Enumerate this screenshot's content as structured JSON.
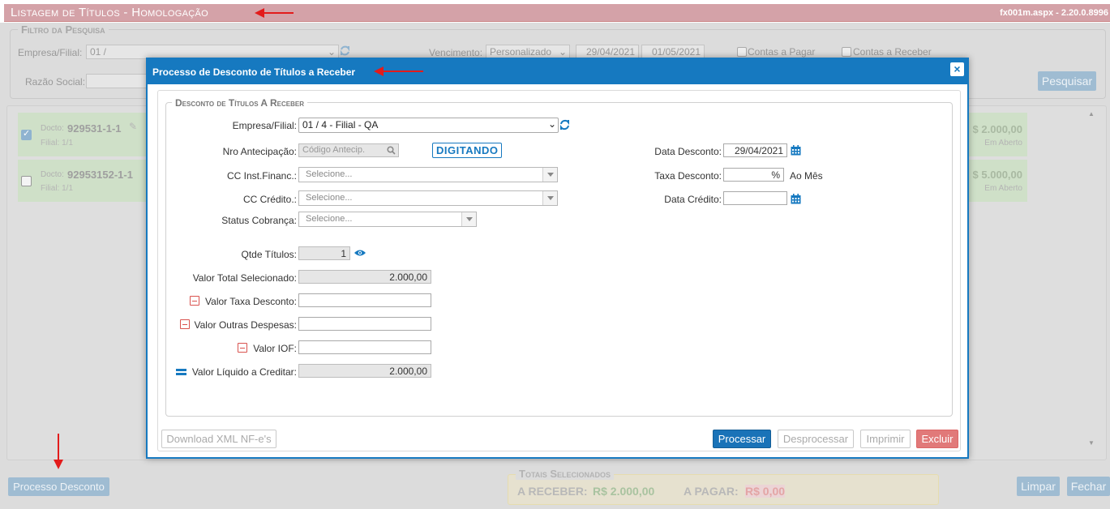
{
  "page": {
    "title": "Listagem de Títulos  - Homologação",
    "version": "fx001m.aspx - 2.20.0.8996"
  },
  "filtro": {
    "legend": "Filtro da Pesquisa",
    "empresa_label": "Empresa/Filial:",
    "empresa_value": "01 /",
    "vencimento_label": "Vencimento:",
    "vencimento_value": "Personalizado",
    "date_from": "29/04/2021",
    "date_to": "01/05/2021",
    "contas_pagar": "Contas a Pagar",
    "contas_receber": "Contas a Receber",
    "razao_label": "Razão Social:",
    "pesquisar": "Pesquisar"
  },
  "list": [
    {
      "docto_label": "Docto:",
      "docto": "929531-1-1",
      "filial": "Filial: 1/1",
      "amount": "$ 2.000,00",
      "status": "Em Aberto",
      "checked": true
    },
    {
      "docto_label": "Docto:",
      "docto": "92953152-1-1",
      "filial": "Filial: 1/1",
      "amount": "$ 5.000,00",
      "status": "Em Aberto",
      "checked": false
    }
  ],
  "bottom": {
    "processo_desconto": "Processo Desconto",
    "totais_legend": "Totais Selecionados",
    "a_receber_label": "A RECEBER:",
    "a_receber_value": "R$ 2.000,00",
    "a_pagar_label": "A PAGAR:",
    "a_pagar_value": "R$ 0,00",
    "limpar": "Limpar",
    "fechar": "Fechar"
  },
  "modal": {
    "title": "Processo de Desconto de Títulos a Receber",
    "legend": "Desconto de Títulos A Receber",
    "empresa_label": "Empresa/Filial:",
    "empresa_value": "01 / 4 - Filial - QA",
    "nro_label": "Nro Antecipação:",
    "nro_placeholder": "Código Antecip.",
    "status_badge": "DIGITANDO",
    "cc_inst_label": "CC Inst.Financ.:",
    "cc_credito_label": "CC Crédito.:",
    "status_cobranca_label": "Status Cobrança:",
    "selecione": "Selecione...",
    "data_desconto_label": "Data Desconto:",
    "data_desconto_value": "29/04/2021",
    "taxa_label": "Taxa Desconto:",
    "taxa_unit": "%",
    "ao_mes": "Ao Mês",
    "data_credito_label": "Data Crédito:",
    "qtde_label": "Qtde Títulos:",
    "qtde_value": "1",
    "valor_total_label": "Valor Total Selecionado:",
    "valor_total_value": "2.000,00",
    "valor_taxa_label": "Valor Taxa Desconto:",
    "valor_outras_label": "Valor Outras Despesas:",
    "valor_iof_label": "Valor IOF:",
    "valor_liquido_label": "Valor Líquido a Creditar:",
    "valor_liquido_value": "2.000,00",
    "btn_download": "Download XML NF-e's",
    "btn_processar": "Processar",
    "btn_desprocessar": "Desprocessar",
    "btn_imprimir": "Imprimir",
    "btn_excluir": "Excluir",
    "close": "×"
  },
  "colors": {
    "primary": "#1679c0",
    "danger": "#e17979",
    "header_bg": "#d4a2a8",
    "annotation_arrow": "#e31b1b"
  }
}
